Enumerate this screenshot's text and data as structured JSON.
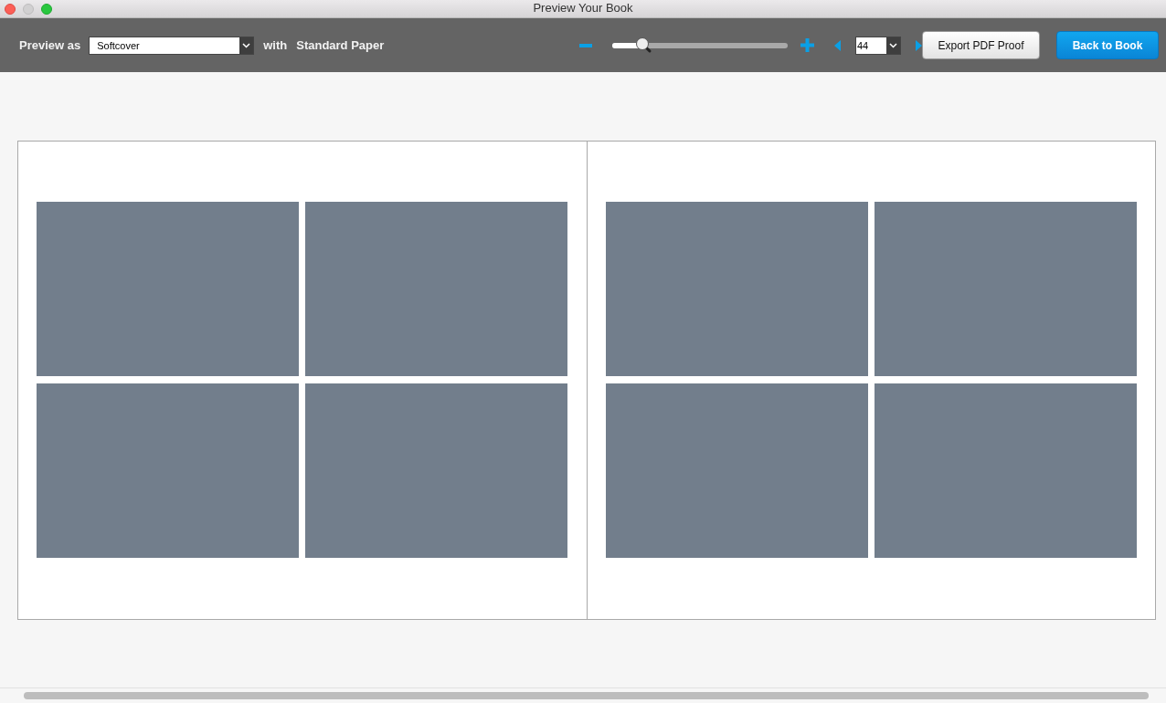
{
  "window": {
    "title": "Preview Your Book"
  },
  "toolbar": {
    "preview_label": "Preview as",
    "cover": {
      "value": "Softcover"
    },
    "with_label": "with",
    "paper": "Standard Paper",
    "zoom": {
      "level": 0.17
    },
    "page": {
      "value": "44"
    },
    "buttons": [
      {
        "label": "Export PDF Proof",
        "kind": "secondary"
      },
      {
        "label": "Back to Book",
        "kind": "primary"
      }
    ]
  },
  "spread": {
    "pages": [
      {
        "slots": [
          {
            "kind": "photo"
          },
          {
            "kind": "photo"
          },
          {
            "kind": "photo"
          },
          {
            "kind": "photo"
          }
        ]
      },
      {
        "slots": [
          {
            "kind": "photo"
          },
          {
            "kind": "photo"
          },
          {
            "kind": "photo"
          },
          {
            "kind": "photo"
          }
        ]
      }
    ]
  }
}
